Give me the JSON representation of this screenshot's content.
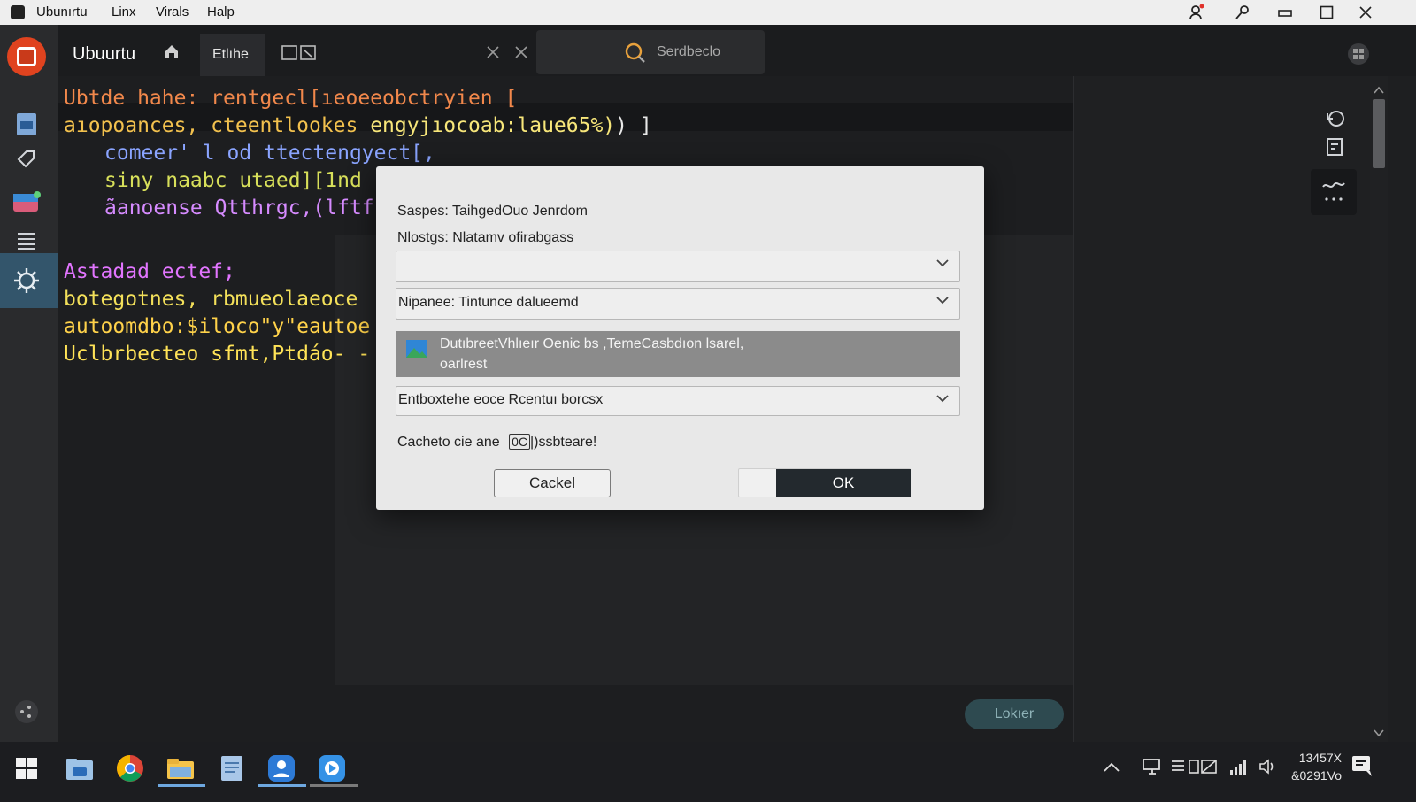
{
  "menubar": {
    "items": [
      "Ubunırtu",
      "Linx",
      "Virals",
      "Halp"
    ]
  },
  "sidebar": {
    "icons": [
      "files-icon",
      "tag-icon",
      "mail-icon",
      "list-icon",
      "settings-icon",
      "extensions-icon"
    ]
  },
  "tabbar": {
    "title": "Ubuurtu",
    "active_tab": "Etlıhe",
    "search_label": "Serdbeclo"
  },
  "editor": {
    "lines": [
      {
        "text": "Ubtde hahe: rentgecl[ıeoeeobctryien [",
        "color": "#f2884b"
      },
      {
        "text": "aıopoances, cteentlookes",
        "color": "#f2c14e"
      },
      {
        "text": "comeer' l od ttectengyect[,",
        "color": "#8aa4ff"
      },
      {
        "text": "siny naabc utaed][1nd",
        "color": "#d8e05a"
      },
      {
        "text": "ãanoense Qtthrgc,(lftf",
        "color": "#d68bff"
      },
      {
        "text": "Astadad ectef;",
        "color": "#e275ff"
      },
      {
        "text": "botegotnes, rbmueolaeoce",
        "color": "#f3e05a"
      },
      {
        "text": "autoomdbo:$iloco\"y\"eautoe",
        "color": "#ffd24a"
      },
      {
        "text": "Uclbrbecteo sfmt,Ptdáo- -",
        "color": "#ffe357"
      }
    ],
    "line2_extra": "engyjıocoab:laue65%)",
    "line2_close": ") ]"
  },
  "modal": {
    "line1": "Saspes: TaihgedOuo Jenrdom",
    "line2": "Nlostgs: Nlatamv ofirabgass",
    "dropdown1_value": "",
    "dropdown2_value": "Nipanee: Tintunce dalueemd",
    "selected_item_line1": "DutıbreetVhlıeır Oenic bs ,TemeCasbdıon lsarel,",
    "selected_item_line2": "oarlrest",
    "dropdown3_value": "Entboxtehe eoce Rcentuı borcsx",
    "footer_text": "Cacheto cie ane",
    "footer_badge": "0C",
    "footer_after": "|)ssbteare!",
    "cancel_label": "Cackel",
    "ok_label": "OK"
  },
  "right_panel": {
    "pill_label": "Lokıer"
  },
  "taskbar": {
    "time": "13457X",
    "date": "&0291Vo"
  },
  "colors": {
    "accent": "#e0431f",
    "active_sidebar": "#33556b",
    "ok_button": "#23292e"
  }
}
